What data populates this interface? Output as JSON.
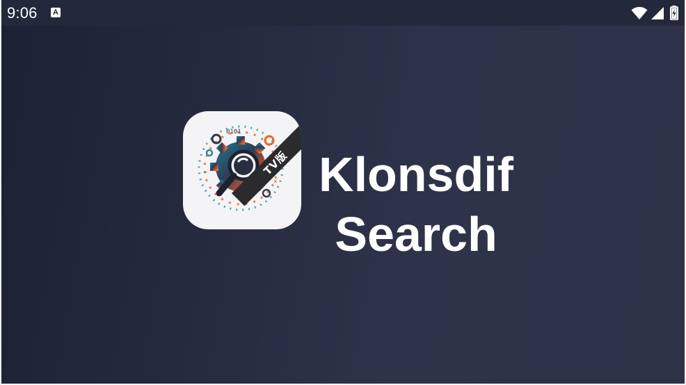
{
  "status_bar": {
    "time": "9:06",
    "notification_icon": "text-a-icon",
    "notification_glyph": "A",
    "icons": [
      "wifi-icon",
      "cell-signal-icon",
      "battery-charging-icon"
    ]
  },
  "splash": {
    "app_icon": "magnifier-gear-logo",
    "ribbon_text": "TV版",
    "title_line1": "Klonsdif",
    "title_line2": "Search"
  },
  "colors": {
    "background": "#2a2f45",
    "status_bar": "#23283a",
    "title": "#ffffff",
    "icon_bg": "#f4f4f6",
    "ribbon": "#2b2b2e"
  }
}
